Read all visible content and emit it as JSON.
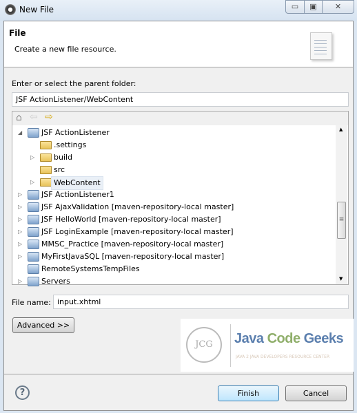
{
  "window": {
    "title": "New File",
    "minimize": "▭",
    "maximize": "▣",
    "close": "✕"
  },
  "header": {
    "title": "File",
    "description": "Create a new file resource.",
    "icon": "new-file-icon"
  },
  "parent_folder": {
    "label": "Enter or select the parent folder:",
    "value": "JSF ActionListener/WebContent"
  },
  "toolbar": {
    "home": "⌂",
    "back": "⇦",
    "forward": "⇨"
  },
  "tree": [
    {
      "label": "JSF ActionListener",
      "level": 0,
      "expanded": true,
      "icon": "project"
    },
    {
      "label": ".settings",
      "level": 1,
      "icon": "folder"
    },
    {
      "label": "build",
      "level": 1,
      "expandable": true,
      "icon": "folder"
    },
    {
      "label": "src",
      "level": 1,
      "icon": "folder"
    },
    {
      "label": "WebContent",
      "level": 1,
      "expandable": true,
      "selected": true,
      "icon": "folder"
    },
    {
      "label": "JSF ActionListener1",
      "level": 0,
      "expandable": true,
      "icon": "project"
    },
    {
      "label": "JSF AjaxValidation  [maven-repository-local master]",
      "level": 0,
      "expandable": true,
      "icon": "project"
    },
    {
      "label": "JSF HelloWorld  [maven-repository-local master]",
      "level": 0,
      "expandable": true,
      "icon": "project"
    },
    {
      "label": "JSF LoginExample  [maven-repository-local master]",
      "level": 0,
      "expandable": true,
      "icon": "project"
    },
    {
      "label": "MMSC_Practice  [maven-repository-local master]",
      "level": 0,
      "expandable": true,
      "icon": "project"
    },
    {
      "label": "MyFirstJavaSQL  [maven-repository-local master]",
      "level": 0,
      "expandable": true,
      "icon": "project"
    },
    {
      "label": "RemoteSystemsTempFiles",
      "level": 0,
      "icon": "project"
    },
    {
      "label": "Servers",
      "level": 0,
      "expandable": true,
      "icon": "project"
    }
  ],
  "file_name": {
    "label": "File name:",
    "value": "input.xhtml"
  },
  "advanced_label": "Advanced >>",
  "logo": {
    "text": "Java Code Geeks",
    "tagline": "JAVA 2 JAVA DEVELOPERS RESOURCE CENTER",
    "badge": "JCG"
  },
  "footer": {
    "help": "?",
    "finish": "Finish",
    "cancel": "Cancel"
  }
}
